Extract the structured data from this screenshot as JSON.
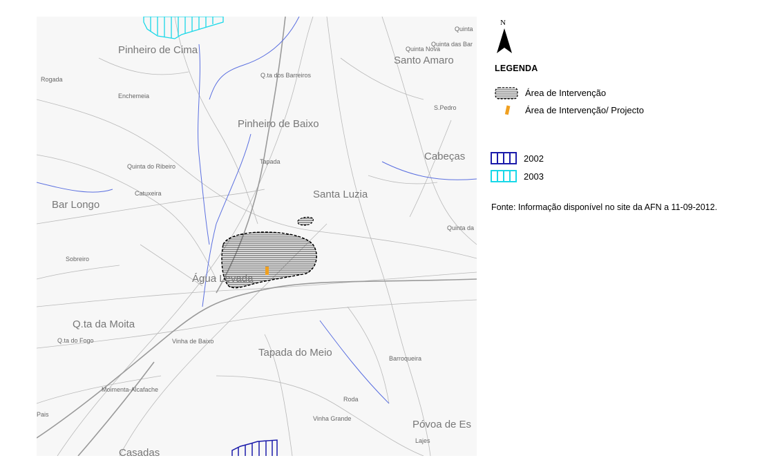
{
  "map": {
    "places_large": [
      "Pinheiro de Cima",
      "Santo Amaro",
      "Pinheiro de Baixo",
      "Cabeças",
      "Santa Luzia",
      "Bar Longo",
      "Água Levada",
      "Q.ta da Moita",
      "Tapada do Meio",
      "Póvoa de Es",
      "Casadas"
    ],
    "places_small": [
      "Quinta",
      "Quinta Nova",
      "Quinta das Bar",
      "Q.ta dos Barreiros",
      "Rogada",
      "Enchemeia",
      "Tapada",
      "Quinta do Ribeiro",
      "Catuxeira",
      "Quinta da",
      "Sobreiro",
      "Q.ta do Fogo",
      "Vinha de Baixo",
      "Barroqueira",
      "Moimenta-Alcafache",
      "Roda",
      "Vinha Grande",
      "Lajes",
      "S.Pedro",
      "Pais"
    ],
    "colors": {
      "roads": "#b5b5b5",
      "streams": "#5a6fe0",
      "area_2002": "#1a1aaa",
      "area_2003": "#18d8e8",
      "project": "#f0a020"
    }
  },
  "legend": {
    "north": "N",
    "title": "LEGENDA",
    "intervention_label": "Área de Intervenção",
    "project_label": "Área de Intervenção/ Projecto",
    "y2002_label": "2002",
    "y2003_label": "2003",
    "source": "Fonte: Informação disponível no site da AFN a 11-09-2012."
  }
}
